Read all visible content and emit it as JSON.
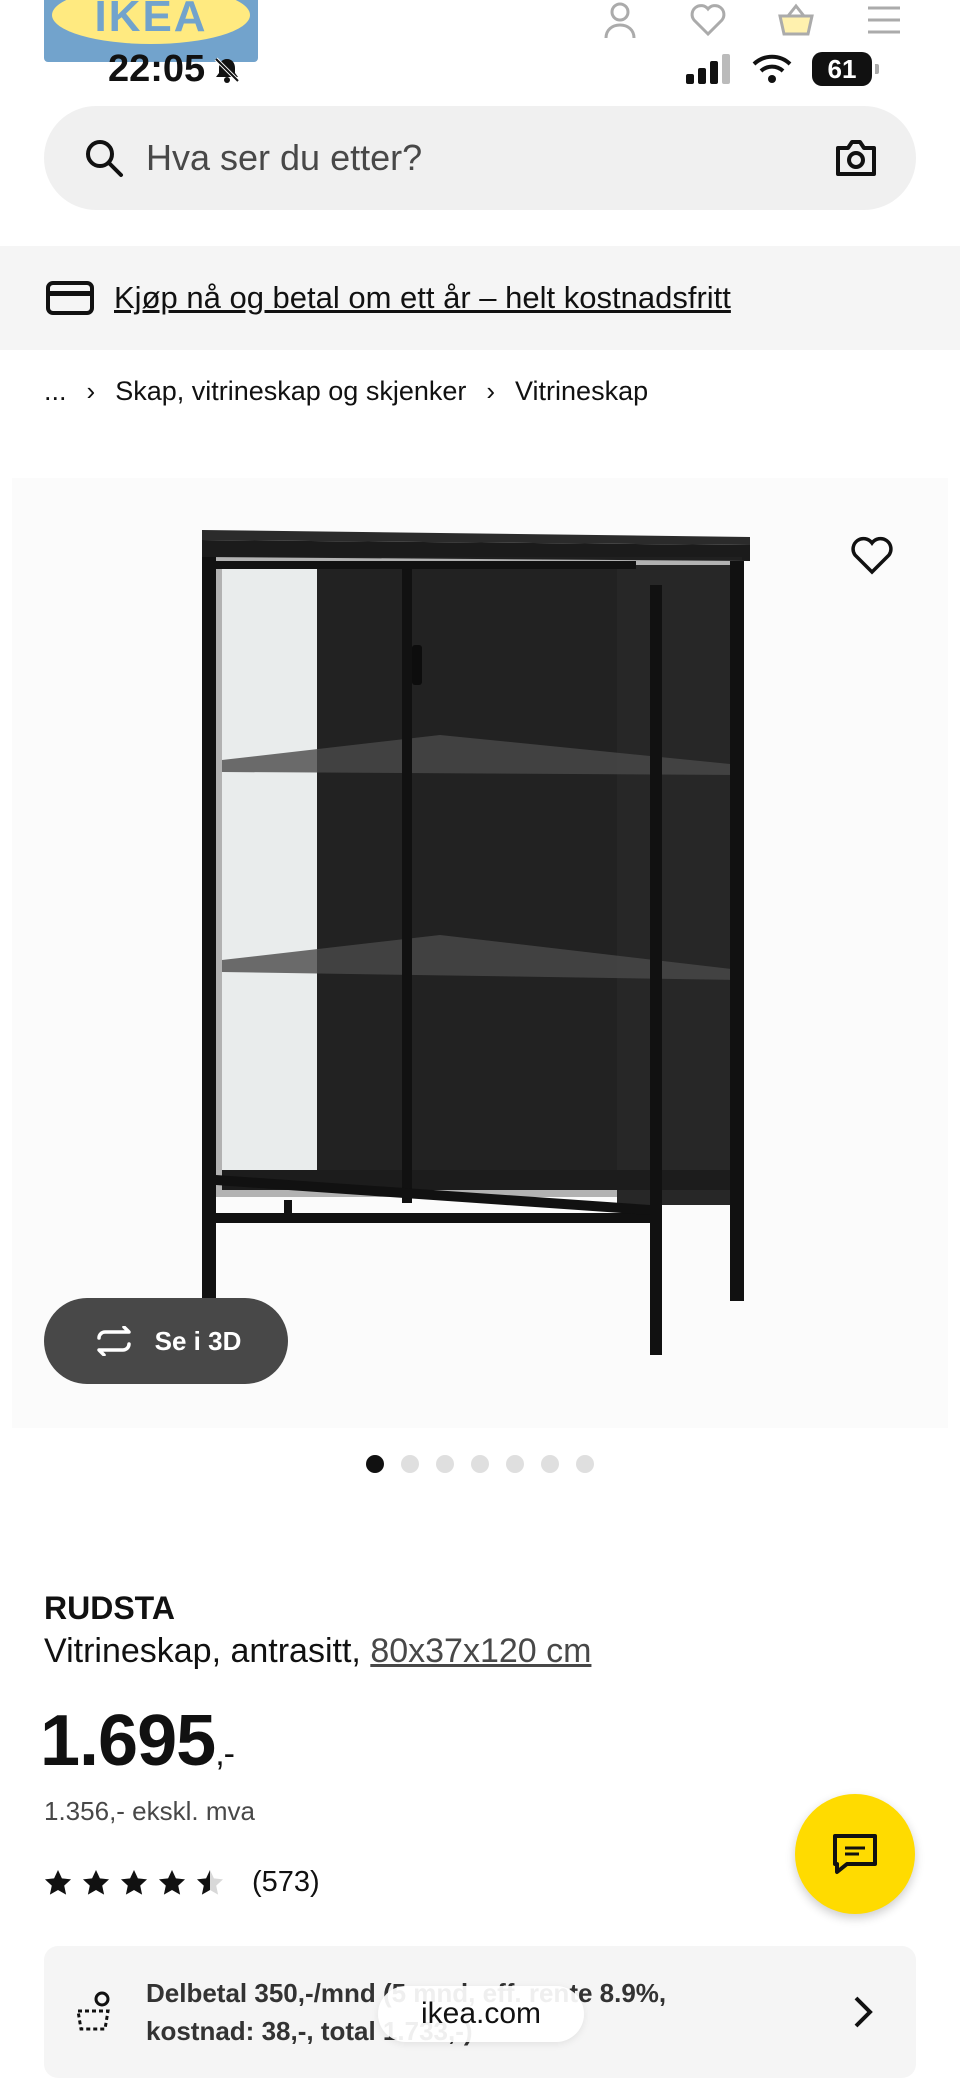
{
  "status": {
    "time": "22:05",
    "battery": "61"
  },
  "brand": {
    "logo_text": "IKEA"
  },
  "search": {
    "placeholder": "Hva ser du etter?"
  },
  "promo": {
    "text": "Kjøp nå og betal om ett år – helt kostnadsfritt"
  },
  "breadcrumb": {
    "ellipsis": "...",
    "items": [
      "Skap, vitrineskap og skjenker",
      "Vitrineskap"
    ]
  },
  "gallery": {
    "view3d_label": "Se i 3D",
    "image_count": 7,
    "active_index": 0
  },
  "product": {
    "name": "RUDSTA",
    "description": "Vitrineskap, antrasitt,",
    "size": "80x37x120 cm",
    "price": "1.695",
    "price_suffix": ",-",
    "price_ex_vat": "1.356,- ekskl. mva",
    "rating": 4.5,
    "review_count": "(573)"
  },
  "finance": {
    "line1": "Delbetal 350,-/mnd (5 mnd, eff. rente 8.9%,",
    "line2": "kostnad: 38,-, total 1.733,-)"
  },
  "browser": {
    "url": "ikea.com"
  },
  "colors": {
    "accent": "#ffdb00",
    "text": "#111111",
    "brand_blue": "#0058a3"
  }
}
